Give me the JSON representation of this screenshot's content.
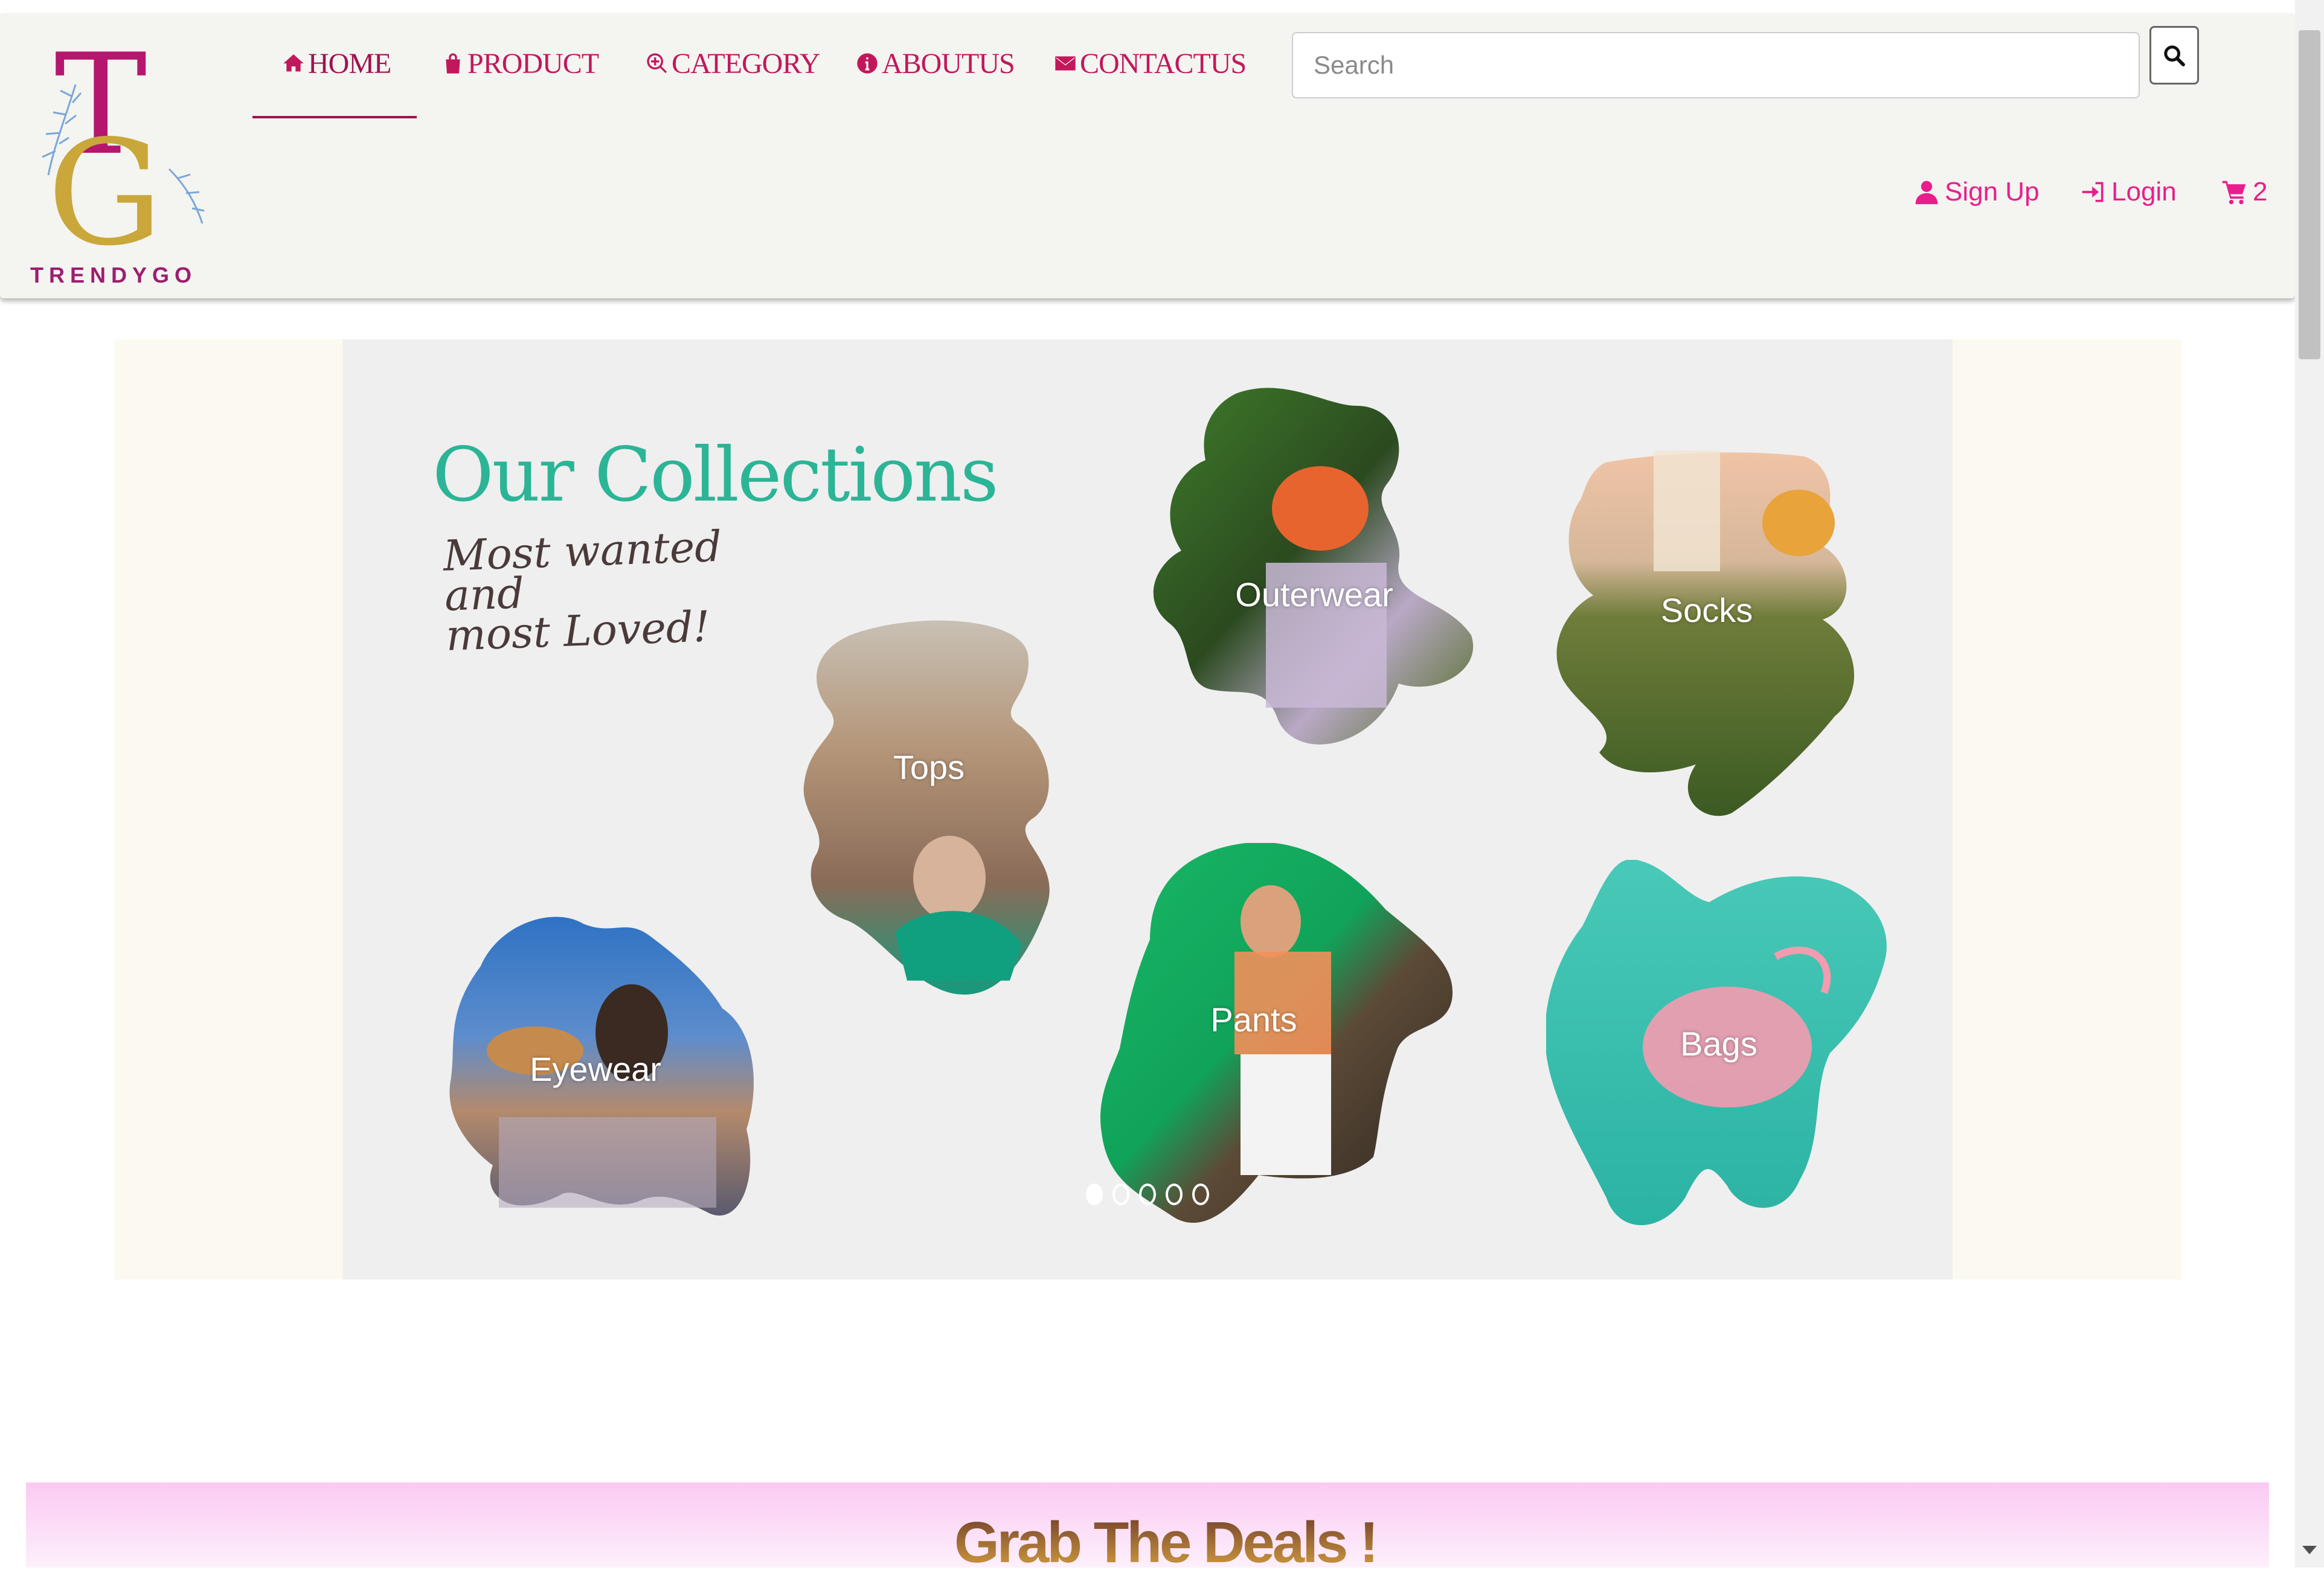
{
  "brand": {
    "monogram_top": "T",
    "monogram_bottom": "G",
    "name": "TRENDYGO"
  },
  "nav": {
    "items": [
      {
        "label": "HOME",
        "icon": "home-icon",
        "active": true
      },
      {
        "label": "PRODUCT",
        "icon": "shopping-bag-icon"
      },
      {
        "label": "CATEGORY",
        "icon": "search-plus-icon"
      },
      {
        "label": "ABOUTUS",
        "icon": "info-circle-icon"
      },
      {
        "label": "CONTACTUS",
        "icon": "envelope-icon"
      }
    ]
  },
  "search": {
    "placeholder": "Search",
    "button_icon": "search-icon"
  },
  "account": {
    "signup_label": "Sign Up",
    "login_label": "Login",
    "cart_count": "2"
  },
  "carousel": {
    "title": "Our Collections",
    "subtitle_line1": "Most wanted and",
    "subtitle_line2": "most Loved!",
    "collections": [
      "Tops",
      "Outerwear",
      "Socks",
      "Eyewear",
      "Pants",
      "Bags"
    ],
    "slide_count": 5,
    "active_slide": 1
  },
  "deals": {
    "title": "Grab The Deals !"
  },
  "colors": {
    "brand_magenta": "#c2185b",
    "accent_pink": "#e91e8c",
    "collections_green": "#2bb596",
    "logo_gold": "#c9a73a"
  }
}
